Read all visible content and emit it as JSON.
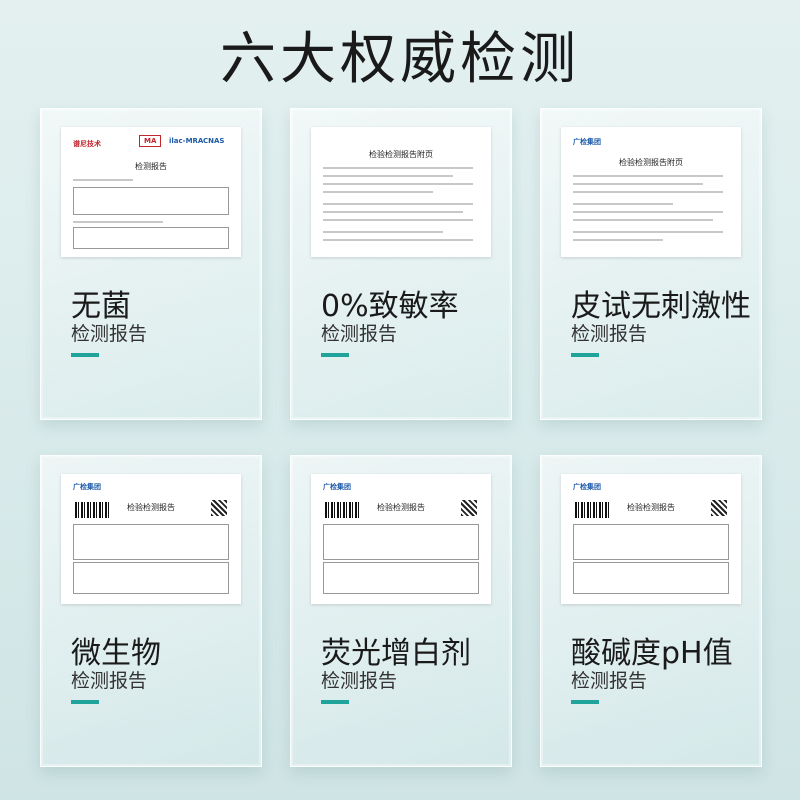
{
  "title": "六大权威检测",
  "colors": {
    "accent": "#1fa39b",
    "text": "#1a1a1a"
  },
  "cards": [
    {
      "label": "无菌",
      "sublabel": "检测报告",
      "doc_title": "检测报告",
      "org": "谱尼技术",
      "marks": [
        "MA",
        "ilac-MRA",
        "CNAS"
      ]
    },
    {
      "label": "0%致敏率",
      "sublabel": "检测报告",
      "doc_title": "检验检测报告附页",
      "org": ""
    },
    {
      "label": "皮试无刺激性",
      "sublabel": "检测报告",
      "doc_title": "检验检测报告附页",
      "org": "广检集团"
    },
    {
      "label": "微生物",
      "sublabel": "检测报告",
      "doc_title": "检验检测报告",
      "org": "广检集团"
    },
    {
      "label": "荧光增白剂",
      "sublabel": "检测报告",
      "doc_title": "检验检测报告",
      "org": "广检集团"
    },
    {
      "label": "酸碱度pH值",
      "sublabel": "检测报告",
      "doc_title": "检验检测报告",
      "org": "广检集团"
    }
  ]
}
